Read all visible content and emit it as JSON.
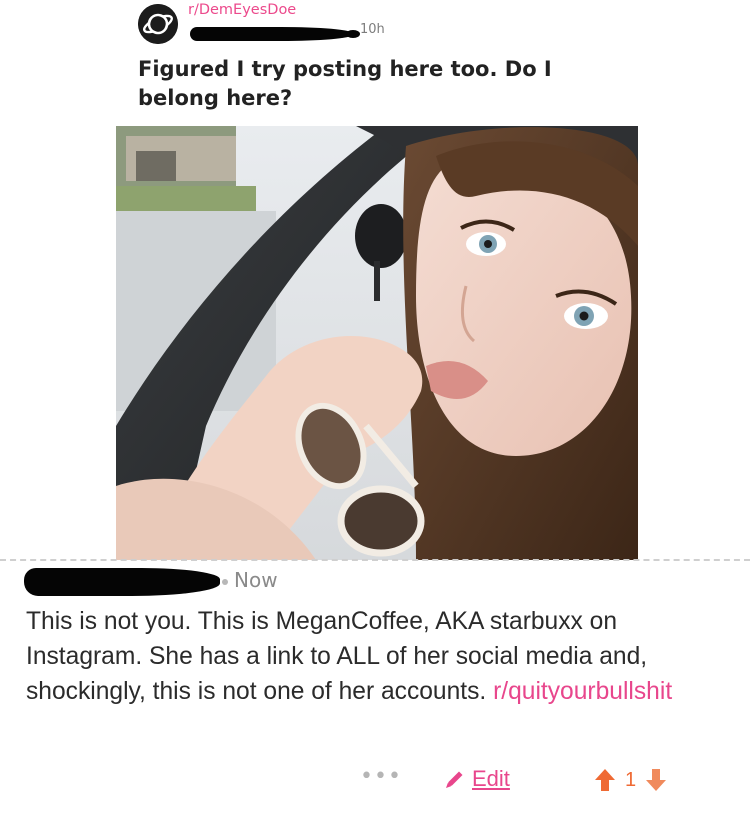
{
  "post": {
    "subreddit": "r/DemEyesDoe",
    "time": "10h",
    "title": "Figured I try posting here too. Do I belong here?"
  },
  "comment": {
    "time": "Now",
    "body_text": "This is not you. This is MeganCoffee, AKA starbuxx on Instagram. She has a link to ALL of her social media and, shockingly, this is not one of her accounts. ",
    "link_text": "r/quityourbullshit"
  },
  "actions": {
    "more_label": "•••",
    "edit_label": "Edit",
    "vote_count": "1"
  },
  "colors": {
    "accent_pink": "#e8468c",
    "upvote_orange": "#ef6a34",
    "downvote_orange": "#f08a5c"
  },
  "icons": {
    "avatar": "planet-icon",
    "edit": "pencil-icon",
    "upvote": "upvote-arrow-icon",
    "downvote": "downvote-arrow-icon"
  }
}
